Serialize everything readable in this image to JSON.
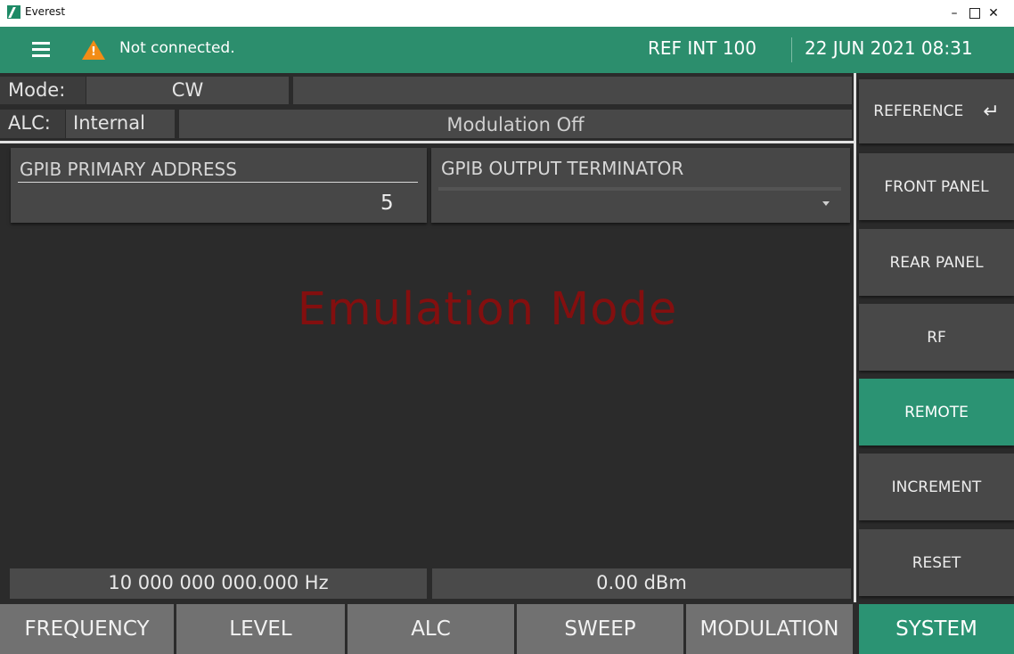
{
  "window": {
    "title": "Everest",
    "minimize": "–",
    "close": "✕"
  },
  "header": {
    "connection_status": "Not connected.",
    "reference_status": "REF INT 100",
    "datetime": "22 JUN 2021 08:31"
  },
  "status": {
    "mode_label": "Mode:",
    "mode_value": "CW",
    "alc_label": "ALC:",
    "alc_value": "Internal",
    "modulation_status": "Modulation Off"
  },
  "fields": {
    "gpib_primary_address": {
      "label": "GPIB PRIMARY ADDRESS",
      "value": "5"
    },
    "gpib_output_terminator": {
      "label": "GPIB OUTPUT TERMINATOR",
      "value": ""
    }
  },
  "emulation_text": "Emulation Mode",
  "readouts": {
    "frequency": "10  000  000  000.000 Hz",
    "level": "0.00 dBm"
  },
  "side_menu": {
    "reference": "REFERENCE",
    "front_panel": "FRONT PANEL",
    "rear_panel": "REAR PANEL",
    "rf": "RF",
    "remote": "REMOTE",
    "increment": "INCREMENT",
    "reset": "RESET"
  },
  "tabs": {
    "frequency": "FREQUENCY",
    "level": "LEVEL",
    "alc": "ALC",
    "sweep": "SWEEP",
    "modulation": "MODULATION",
    "system": "SYSTEM"
  },
  "colors": {
    "accent": "#2c8e6d",
    "warning": "#f28c16",
    "emulation_text": "#830f0f"
  }
}
